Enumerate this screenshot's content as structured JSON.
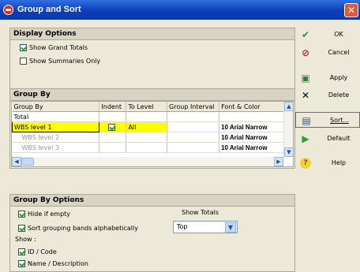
{
  "window": {
    "title": "Group and Sort"
  },
  "display_options": {
    "header": "Display Options",
    "show_grand_totals": {
      "label": "Show Grand Totals",
      "checked": true
    },
    "show_summaries_only": {
      "label": "Show Summaries Only",
      "checked": false
    }
  },
  "group_by": {
    "header": "Group By",
    "columns": [
      "Group By",
      "Indent",
      "To Level",
      "Group Interval",
      "Font & Color"
    ],
    "rows": [
      {
        "group_by": "Total",
        "indent": "",
        "to_level": "",
        "interval": "",
        "font": ""
      },
      {
        "group_by": "WBS level 1",
        "indent": "✓",
        "to_level": "All",
        "interval": "",
        "font": "10 Arial Narrow"
      },
      {
        "group_by": "WBS level 2",
        "indent": "",
        "to_level": "",
        "interval": "",
        "font": "10 Arial Narrow"
      },
      {
        "group_by": "WBS level 3",
        "indent": "",
        "to_level": "",
        "interval": "",
        "font": "10 Arial Narrow"
      }
    ]
  },
  "group_by_options": {
    "header": "Group By Options",
    "hide_if_empty": {
      "label": "Hide if empty",
      "checked": true
    },
    "sort_bands": {
      "label": "Sort grouping bands alphabetically",
      "checked": true
    },
    "show_label": "Show :",
    "id_code": {
      "label": "ID / Code",
      "checked": true
    },
    "name_desc": {
      "label": "Name / Description",
      "checked": true
    },
    "show_totals_label": "Show Totals",
    "show_totals_value": "Top"
  },
  "buttons": {
    "ok": "OK",
    "cancel": "Cancel",
    "apply": "Apply",
    "delete": "Delete",
    "sort": "Sort...",
    "default": "Default",
    "help": "Help"
  },
  "colors": {
    "title_bar": "#0a3fb8",
    "selected_row": "#ffff00",
    "dialog_bg": "#ece9d8"
  }
}
